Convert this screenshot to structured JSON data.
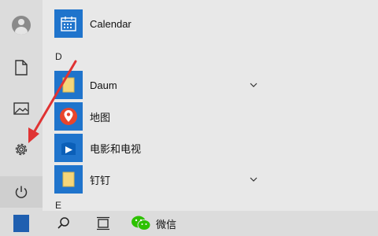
{
  "rail": {
    "items": [
      {
        "name": "user-avatar"
      },
      {
        "name": "documents"
      },
      {
        "name": "pictures"
      },
      {
        "name": "settings"
      },
      {
        "name": "power"
      }
    ]
  },
  "app_list": {
    "items": [
      {
        "type": "app",
        "label": "Calendar",
        "icon": "calendar-icon"
      },
      {
        "type": "letter",
        "label": "D"
      },
      {
        "type": "app",
        "label": "Daum",
        "icon": "folder-icon",
        "expandable": true
      },
      {
        "type": "app",
        "label": "地图",
        "icon": "map-icon"
      },
      {
        "type": "app",
        "label": "电影和电视",
        "icon": "movies-tv-icon"
      },
      {
        "type": "app",
        "label": "钉钉",
        "icon": "folder-icon",
        "expandable": true
      },
      {
        "type": "letter",
        "label": "E"
      }
    ]
  },
  "taskbar": {
    "wechat_label": "微信"
  },
  "colors": {
    "accent": "#1f74cc",
    "arrow": "#e03333",
    "folder": "#f5d67a"
  }
}
